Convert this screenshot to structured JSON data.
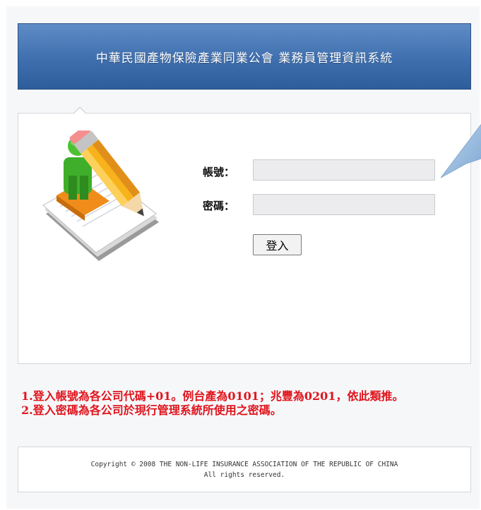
{
  "header": {
    "title": "中華民國產物保險產業同業公會 業務員管理資訊系統"
  },
  "login": {
    "account_label": "帳號：",
    "account_value": "",
    "password_label": "密碼：",
    "password_value": "",
    "login_button_label": "登入"
  },
  "notes": [
    "1.登入帳號為各公司代碼+01。例台產為0101；兆豐為0201，依此類推。",
    "2.登入密碼為各公司於現行管理系統所使用之密碼。"
  ],
  "footer": {
    "copyright_line": "Copyright © 2008 THE NON-LIFE INSURANCE ASSOCIATION OF THE REPUBLIC OF CHINA",
    "rights_line": "All rights reserved."
  },
  "colors": {
    "header_blue": "#3f6fae",
    "note_red": "#e0151d",
    "panel_border": "#d4d6da"
  },
  "icons": {
    "illustration": "user-with-pencil-icon",
    "bubble": "speech-bubble-icon"
  }
}
